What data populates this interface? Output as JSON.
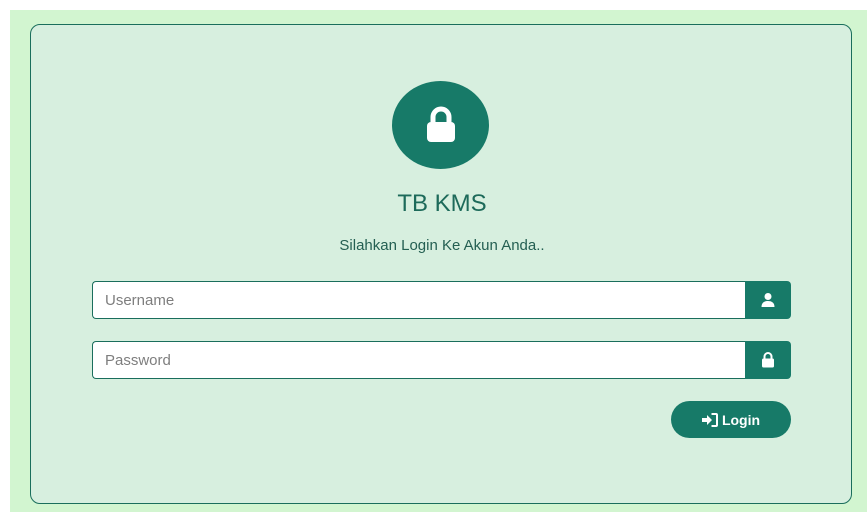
{
  "app": {
    "title": "TB KMS",
    "subtitle": "Silahkan Login Ke Akun Anda.."
  },
  "form": {
    "username": {
      "value": "",
      "placeholder": "Username",
      "icon": "user-icon"
    },
    "password": {
      "value": "",
      "placeholder": "Password",
      "icon": "lock-icon"
    },
    "login_label": "Login",
    "login_icon": "sign-in-icon"
  },
  "colors": {
    "page_background": "#d2f5d0",
    "card_background": "#d7efdf",
    "accent": "#177a68",
    "border": "#1a6e5c",
    "title_text": "#1d6a5a"
  },
  "header_icon": "lock-icon"
}
